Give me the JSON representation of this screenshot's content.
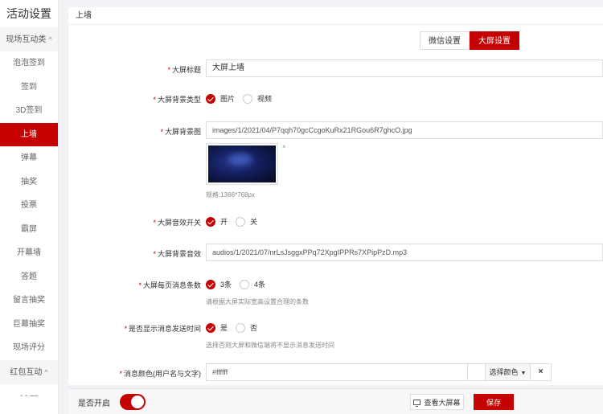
{
  "sidebar": {
    "title": "活动设置",
    "groups": [
      {
        "label": "现场互动类",
        "chevron": "^"
      },
      {
        "label": "红包互动",
        "chevron": "^"
      }
    ],
    "items": [
      {
        "label": "泡泡签到"
      },
      {
        "label": "签到"
      },
      {
        "label": "3D签到"
      },
      {
        "label": "上墙"
      },
      {
        "label": "弹幕"
      },
      {
        "label": "抽奖"
      },
      {
        "label": "投票"
      },
      {
        "label": "霸屏"
      },
      {
        "label": "开幕墙"
      },
      {
        "label": "答题"
      },
      {
        "label": "留言抽奖"
      },
      {
        "label": "巨幕抽奖"
      },
      {
        "label": "现场评分"
      }
    ],
    "active_item": "上墙",
    "trailing": "- - —"
  },
  "header": {
    "title": "上墙"
  },
  "tabs": [
    {
      "label": "微信设置",
      "active": false
    },
    {
      "label": "大屏设置",
      "active": true
    }
  ],
  "form": {
    "title": {
      "label": "大屏标题",
      "value": "大屏上墙"
    },
    "bg_type": {
      "label": "大屏背景类型",
      "options": [
        "图片",
        "视频"
      ],
      "selected": "图片"
    },
    "bg_image": {
      "label": "大屏背景图",
      "value": "images/1/2021/04/P7qqh70gcCcgoKuRx21RGou6R7ghcO.jpg",
      "remove_icon": "×",
      "hint": "规格:1366*768px"
    },
    "sound_switch": {
      "label": "大屏音效开关",
      "options": [
        "开",
        "关"
      ],
      "selected": "开"
    },
    "bg_sound": {
      "label": "大屏背景音效",
      "value": "audios/1/2021/07/nrLsJsggxPPq72XpgIPPRs7XPipPzD.mp3"
    },
    "msg_count": {
      "label": "大屏每页消息条数",
      "options": [
        "3条",
        "4条"
      ],
      "selected": "3条",
      "hint": "请根据大屏实际宽高设置合理的条数"
    },
    "show_time": {
      "label": "是否显示消息发送时间",
      "options": [
        "是",
        "否"
      ],
      "selected": "是",
      "hint": "选择否则大屏和微信端将不显示消息发送时间"
    },
    "msg_color": {
      "label": "消息颜色(用户名与文字)",
      "value": "#ffffff",
      "pick_label": "选择颜色",
      "clear_label": "×"
    }
  },
  "bottom": {
    "enable_label": "是否开启",
    "enabled": true,
    "preview_label": "查看大屏幕",
    "save_label": "保存"
  },
  "colors": {
    "accent": "#c40000"
  }
}
